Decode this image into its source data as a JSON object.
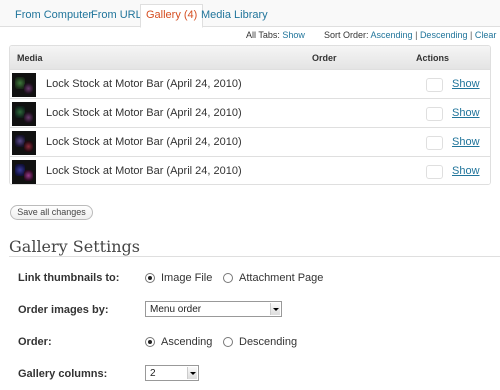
{
  "tabs": [
    {
      "label": "From Computer",
      "active": false
    },
    {
      "label": "From URL",
      "active": false
    },
    {
      "label": "Gallery (4)",
      "active": true
    },
    {
      "label": "Media Library",
      "active": false
    }
  ],
  "all_tabs": {
    "label": "All Tabs:",
    "link": "Show"
  },
  "sort_order": {
    "label": "Sort Order:",
    "ascending": "Ascending",
    "sep": "|",
    "descending": "Descending",
    "clear": "Clear"
  },
  "table": {
    "headers": {
      "media": "Media",
      "order": "Order",
      "actions": "Actions"
    },
    "rows": [
      {
        "title": "Lock Stock at Motor Bar (April 24, 2010)",
        "action": "Show"
      },
      {
        "title": "Lock Stock at Motor Bar (April 24, 2010)",
        "action": "Show"
      },
      {
        "title": "Lock Stock at Motor Bar (April 24, 2010)",
        "action": "Show"
      },
      {
        "title": "Lock Stock at Motor Bar (April 24, 2010)",
        "action": "Show"
      }
    ]
  },
  "save_button": "Save all changes",
  "gallery_settings": {
    "title": "Gallery Settings",
    "link_thumbnails": {
      "label": "Link thumbnails to:",
      "options": [
        "Image File",
        "Attachment Page"
      ],
      "selected": "Image File"
    },
    "order_images_by": {
      "label": "Order images by:",
      "value": "Menu order"
    },
    "order": {
      "label": "Order:",
      "options": [
        "Ascending",
        "Descending"
      ],
      "selected": "Ascending"
    },
    "gallery_columns": {
      "label": "Gallery columns:",
      "value": "2"
    }
  },
  "colors": {
    "link": "#21759b",
    "active_tab": "#d54e21",
    "border": "#dfdfdf"
  }
}
